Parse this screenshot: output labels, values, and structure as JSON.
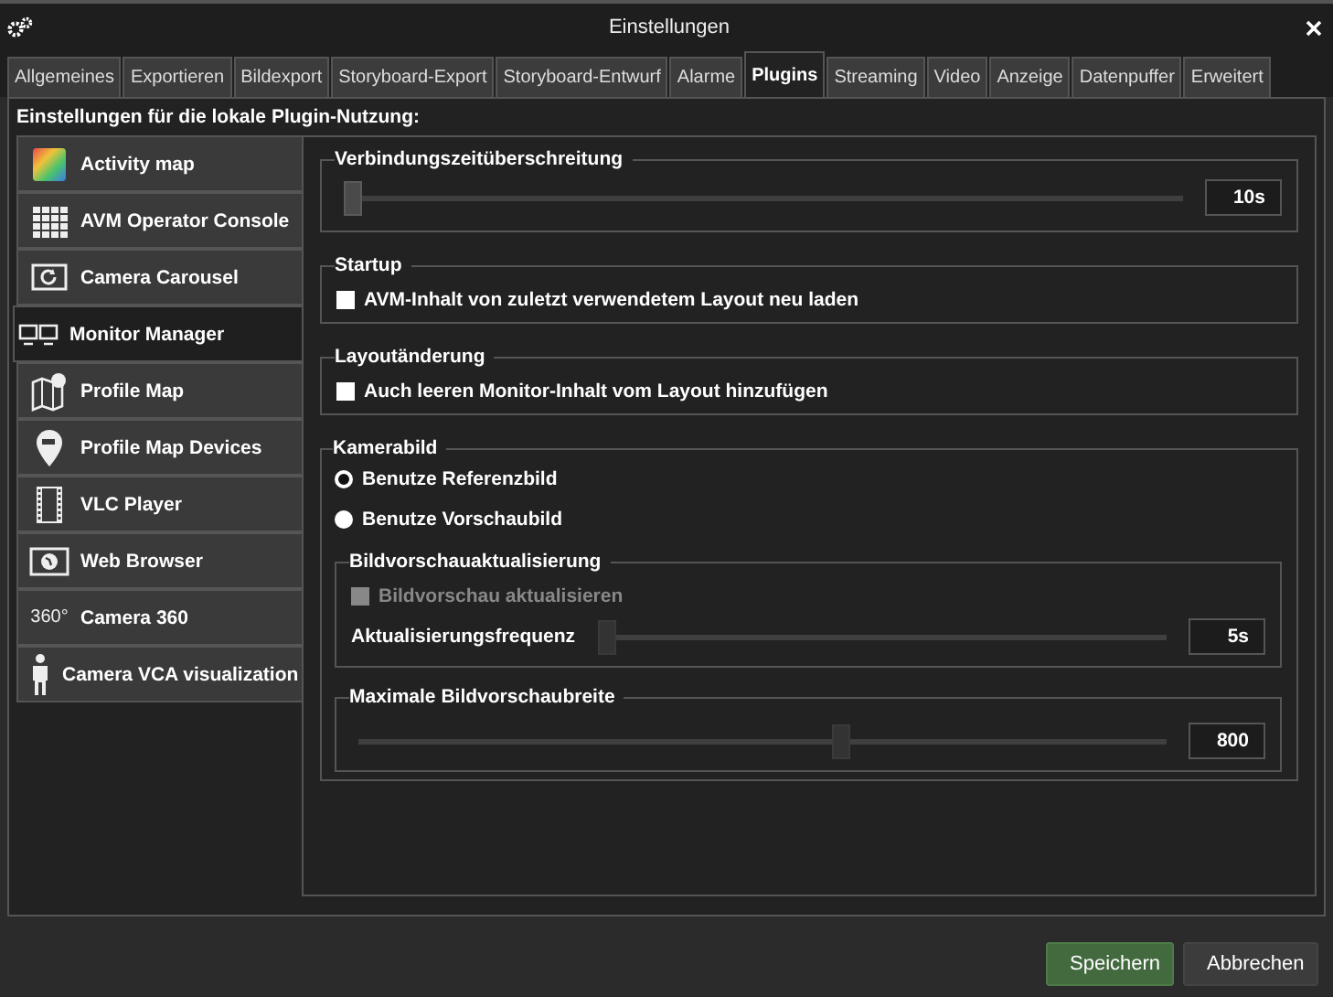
{
  "window": {
    "title": "Einstellungen"
  },
  "tabs": [
    {
      "label": "Allgemeines",
      "selected": false
    },
    {
      "label": "Exportieren",
      "selected": false
    },
    {
      "label": "Bildexport",
      "selected": false
    },
    {
      "label": "Storyboard-Export",
      "selected": false
    },
    {
      "label": "Storyboard-Entwurf",
      "selected": false
    },
    {
      "label": "Alarme",
      "selected": false
    },
    {
      "label": "Plugins",
      "selected": true
    },
    {
      "label": "Streaming",
      "selected": false
    },
    {
      "label": "Video",
      "selected": false
    },
    {
      "label": "Anzeige",
      "selected": false
    },
    {
      "label": "Datenpuffer",
      "selected": false
    },
    {
      "label": "Erweitert",
      "selected": false
    }
  ],
  "heading": "Einstellungen für die lokale Plugin-Nutzung:",
  "sidebar": {
    "items": [
      {
        "label": "Activity map",
        "selected": false
      },
      {
        "label": "AVM Operator Console",
        "selected": false
      },
      {
        "label": "Camera Carousel",
        "selected": false
      },
      {
        "label": "Monitor Manager",
        "selected": true
      },
      {
        "label": "Profile Map",
        "selected": false
      },
      {
        "label": "Profile Map Devices",
        "selected": false
      },
      {
        "label": "VLC Player",
        "selected": false
      },
      {
        "label": "Web Browser",
        "selected": false
      },
      {
        "label": "Camera 360",
        "selected": false,
        "icon_text": "360°"
      },
      {
        "label": "Camera VCA visualization",
        "selected": false
      }
    ]
  },
  "connection_timeout": {
    "title": "Verbindungszeitüberschreitung",
    "level": 0,
    "value": "10s"
  },
  "startup": {
    "title": "Startup",
    "checkbox": {
      "label": "AVM-Inhalt von zuletzt verwendetem Layout neu laden",
      "checked": false
    }
  },
  "layout_change": {
    "title": "Layoutänderung",
    "checkbox": {
      "label": "Auch leeren Monitor-Inhalt vom Layout hinzufügen",
      "checked": false
    }
  },
  "camera_image": {
    "title": "Kamerabild",
    "radios": [
      {
        "label": "Benutze Referenzbild",
        "selected": true
      },
      {
        "label": "Benutze Vorschaubild",
        "selected": false
      }
    ],
    "preview_update": {
      "title": "Bildvorschauaktualisierung",
      "checkbox": {
        "label": "Bildvorschau aktualisieren",
        "checked": false,
        "disabled": true
      },
      "frequency": {
        "label": "Aktualisierungsfrequenz",
        "level": 0,
        "value": "5s",
        "disabled": true
      }
    },
    "max_preview_width": {
      "title": "Maximale Bildvorschaubreite",
      "level": 0.6,
      "value": "800",
      "disabled": true
    }
  },
  "buttons": [
    {
      "label": "Speichern",
      "kind": "primary"
    },
    {
      "label": "Abbrechen",
      "kind": "secondary"
    }
  ]
}
